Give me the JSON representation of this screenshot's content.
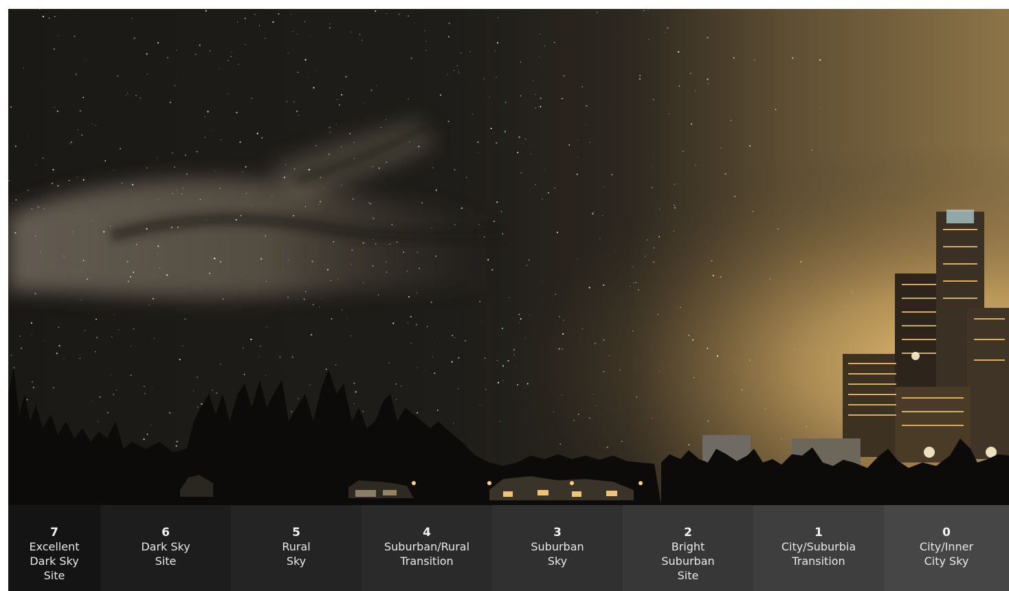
{
  "scale": [
    {
      "number": "7",
      "label": "Excellent\nDark Sky\nSite",
      "bg": "#141414"
    },
    {
      "number": "6",
      "label": "Dark Sky\nSite",
      "bg": "#1d1d1d"
    },
    {
      "number": "5",
      "label": "Rural\nSky",
      "bg": "#242424"
    },
    {
      "number": "4",
      "label": "Suburban/Rural\nTransition",
      "bg": "#2a2a2a"
    },
    {
      "number": "3",
      "label": "Suburban\nSky",
      "bg": "#303030"
    },
    {
      "number": "2",
      "label": "Bright\nSuburban\nSite",
      "bg": "#373737"
    },
    {
      "number": "1",
      "label": "City/Suburbia\nTransition",
      "bg": "#3e3e3e"
    },
    {
      "number": "0",
      "label": "City/Inner\nCity Sky",
      "bg": "#464646"
    }
  ],
  "colors": {
    "dark_sky": "#1c1a17",
    "city_glow": "#c8a565",
    "milky_way": "#8a7f6d",
    "silhouette": "#0d0c0a",
    "window_light": "#f4c56c"
  }
}
